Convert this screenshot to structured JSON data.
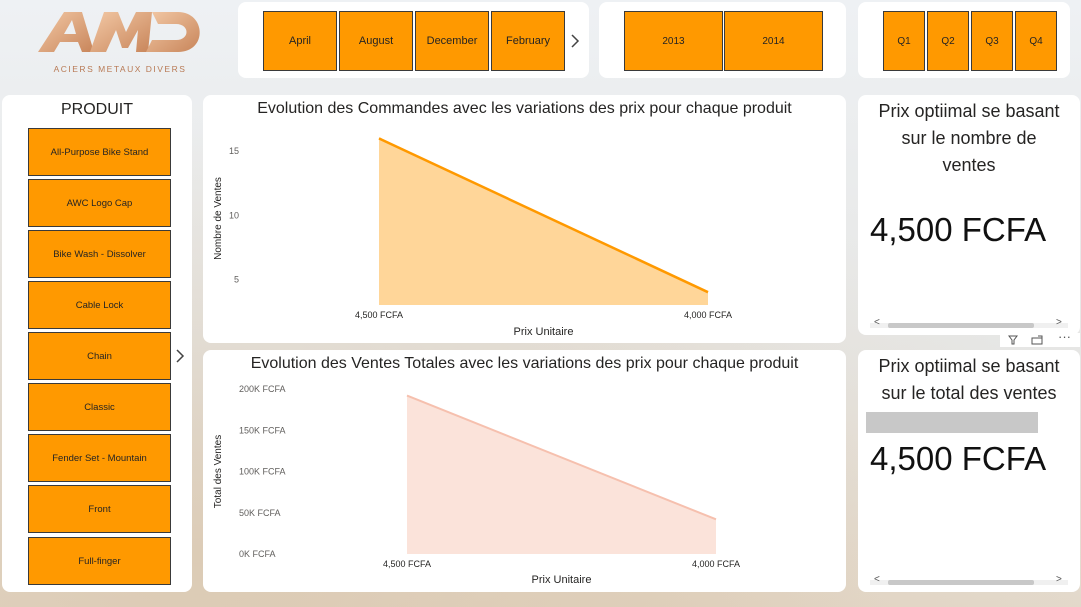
{
  "logo": {
    "text": "AMD",
    "subtitle": "ACIERS METAUX DIVERS"
  },
  "months": [
    "April",
    "August",
    "December",
    "February"
  ],
  "years": [
    "2013",
    "2014"
  ],
  "quarters": [
    "Q1",
    "Q2",
    "Q3",
    "Q4"
  ],
  "produit": {
    "title": "PRODUIT",
    "items": [
      "All-Purpose Bike Stand",
      "AWC Logo Cap",
      "Bike Wash - Dissolver",
      "Cable Lock",
      "Chain",
      "Classic",
      "Fender Set - Mountain",
      "Front",
      "Full-finger"
    ]
  },
  "colors": {
    "accent": "#ff9900",
    "line1": "#ff9900",
    "area1": "#ffd699",
    "line2": "#f6c0ae",
    "area2": "#fbe3da"
  },
  "chart1": {
    "title": "Evolution des Commandes avec les variations des prix pour chaque produit",
    "xlabel": "Prix Unitaire",
    "ylabel": "Nombre de Ventes",
    "yticks": [
      "15",
      "10",
      "5"
    ],
    "chart_data": {
      "type": "area",
      "categories": [
        "4,500 FCFA",
        "4,000 FCFA"
      ],
      "values": [
        16,
        4
      ],
      "ylim": [
        3,
        16.5
      ],
      "ytick_values": [
        15,
        10,
        5
      ]
    }
  },
  "chart2": {
    "title": "Evolution des Ventes Totales avec les variations des prix pour chaque produit",
    "xlabel": "Prix Unitaire",
    "ylabel": "Total des Ventes",
    "yticks": [
      "200K FCFA",
      "150K FCFA",
      "100K FCFA",
      "50K FCFA",
      "0K FCFA"
    ],
    "chart_data": {
      "type": "area",
      "categories": [
        "4,500 FCFA",
        "4,000 FCFA"
      ],
      "values": [
        192000,
        42000
      ],
      "ylim": [
        0,
        200000
      ],
      "ytick_values": [
        200000,
        150000,
        100000,
        50000,
        0
      ]
    }
  },
  "kpi1": {
    "title_lines": [
      "Prix optiimal se basant",
      "sur le nombre de",
      "ventes"
    ],
    "value": "4,500 FCFA"
  },
  "kpi2": {
    "title_lines": [
      "Prix optiimal se basant",
      "sur le total des ventes"
    ],
    "value": "4,500 FCFA"
  },
  "scroll_arrows": {
    "left": "<",
    "right": ">"
  },
  "more_options": "···"
}
